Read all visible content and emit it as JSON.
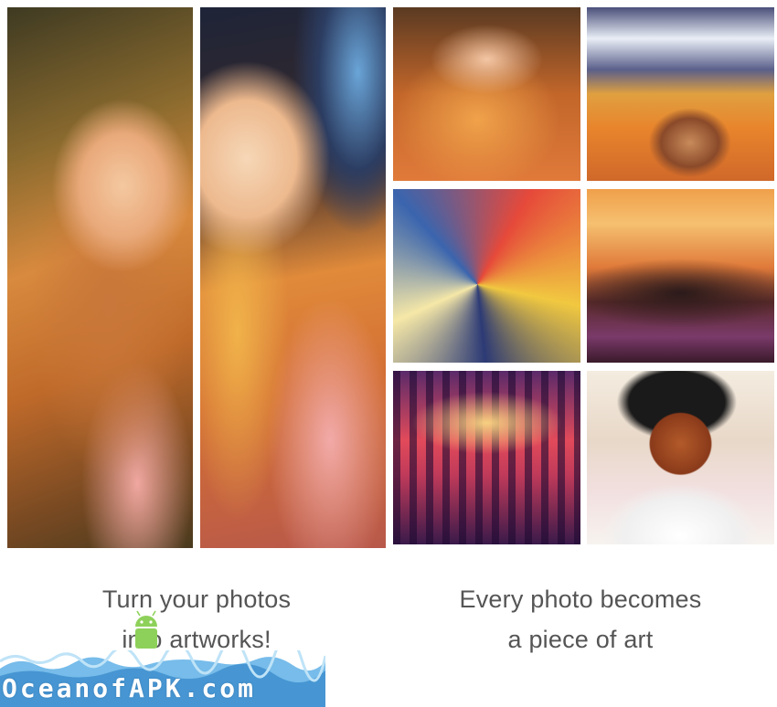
{
  "left_panel": {
    "caption_line1": "Turn your photos",
    "caption_line2": "into artworks!"
  },
  "right_panel": {
    "caption_line1": "Every photo becomes",
    "caption_line2": "a piece of art"
  },
  "watermark": {
    "text": "OceanofAPK.com",
    "icon": "android-icon"
  },
  "colors": {
    "caption_text": "#555555",
    "background": "#ffffff",
    "watermark_wave": "#5fb0e6"
  }
}
